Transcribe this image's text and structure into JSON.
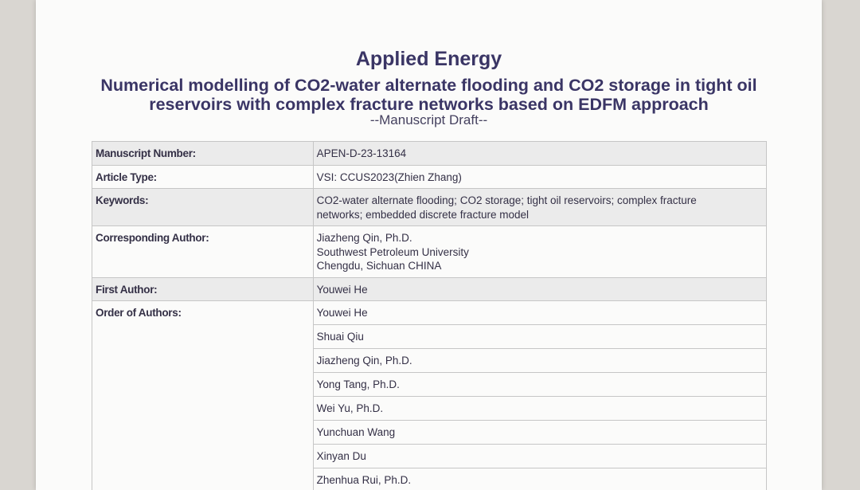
{
  "document": {
    "journal": "Applied Energy",
    "title_line1": "Numerical modelling of CO2-water alternate flooding and CO2 storage in tight oil",
    "title_line2": "reservoirs with complex fracture networks based on EDFM approach",
    "draft_label": "--Manuscript Draft--"
  },
  "fields": {
    "manuscript_number": {
      "label": "Manuscript Number:",
      "value": "APEN-D-23-13164"
    },
    "article_type": {
      "label": "Article Type:",
      "value": "VSI: CCUS2023(Zhien Zhang)"
    },
    "keywords": {
      "label": "Keywords:",
      "line1": "CO2-water alternate flooding;  CO2 storage;  tight oil reservoirs;  complex fracture",
      "line2": "networks;  embedded discrete fracture model"
    },
    "corresponding_author": {
      "label": "Corresponding Author:",
      "line1": "Jiazheng Qin, Ph.D.",
      "line2": "Southwest Petroleum University",
      "line3": "Chengdu, Sichuan CHINA"
    },
    "first_author": {
      "label": "First Author:",
      "value": "Youwei He"
    },
    "order_of_authors": {
      "label": "Order of Authors:",
      "authors": [
        "Youwei He",
        "Shuai Qiu",
        "Jiazheng Qin, Ph.D.",
        "Yong Tang, Ph.D.",
        "Wei Yu, Ph.D.",
        "Yunchuan Wang",
        "Xinyan Du",
        "Zhenhua Rui, Ph.D."
      ]
    }
  }
}
